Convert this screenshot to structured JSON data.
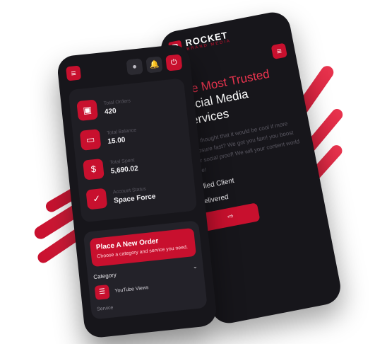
{
  "brand": {
    "name": "ROCKET",
    "tagline": "BRAND MEDIA"
  },
  "hero": {
    "heading_accent": "The Most Trusted",
    "heading_rest": " Social Media Services",
    "body": "ever thought that it would be cool if more exposure fast? We got you fam! you boost your social proof! We will your content world wide!",
    "stat_1": "tisfied Client",
    "stat_2": "Delivered"
  },
  "dashboard": {
    "total_orders_label": "Total Orders",
    "total_orders_value": "420",
    "total_balance_label": "Total Balance",
    "total_balance_value": "15.00",
    "total_spent_label": "Total Spent",
    "total_spent_value": "5,690.02",
    "account_status_label": "Account Status",
    "account_status_value": "Space Force"
  },
  "order": {
    "title": "Place A New Order",
    "description": "Choose a category and service you need.",
    "category_label": "Category",
    "category_value": "YouTube Views",
    "service_label": "Service"
  },
  "colors": {
    "accent": "#c8102e",
    "phone_bg": "#17161b",
    "card_bg": "#1f1e24"
  },
  "icons": {
    "menu": "hamburger-icon",
    "profile": "user-icon",
    "notifications": "bell-icon",
    "logout": "power-icon",
    "orders": "package-icon",
    "balance": "wallet-icon",
    "spent": "money-icon",
    "status": "shield-check-icon",
    "category": "list-icon",
    "dropdown": "chevron-down-icon"
  }
}
